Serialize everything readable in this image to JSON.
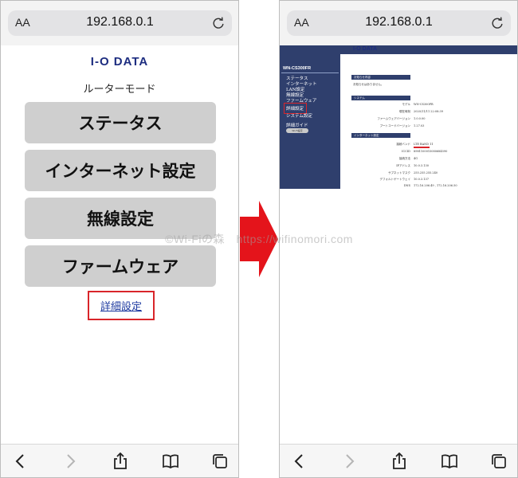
{
  "browser": {
    "url": "192.168.0.1",
    "text_size_label": "AA",
    "icons": [
      "reload-icon",
      "back-icon",
      "forward-icon",
      "share-icon",
      "bookmarks-icon",
      "tabs-icon"
    ]
  },
  "left_page": {
    "logo": "I-O DATA",
    "mode_label": "ルーターモード",
    "menu": [
      "ステータス",
      "インターネット設定",
      "無線設定",
      "ファームウェア"
    ],
    "advanced_link": "詳細設定"
  },
  "right_page": {
    "logo": "I-O DATA",
    "model": "WN-CS300FR",
    "sidebar_items": [
      "ステータス",
      "インターネット",
      "LAN設定",
      "無線設定",
      "ファームウェア",
      "詳細設定",
      "システム設定"
    ],
    "sidebar_guide": "詳細ガイド",
    "sidebar_button": "Wi-Fi設定",
    "sections": {
      "notice_title": "お知らせ内容",
      "notice_text": "お知らせはありません。",
      "system_title": "システム",
      "system_rows": [
        {
          "label": "モデル",
          "value": "WN-CS300FR"
        },
        {
          "label": "現在時刻",
          "value": "2020/11/11 22:08:39"
        },
        {
          "label": "ファームウェアバージョン",
          "value": "1.0.0.00"
        },
        {
          "label": "ブートコードバージョン",
          "value": "1.27.03"
        }
      ],
      "internet_title": "インターネット設定",
      "internet_rows": [
        {
          "label": "接続バンド",
          "value": "LTE BAND 11"
        },
        {
          "label": "ICCID",
          "value": "8981100015080684590"
        },
        {
          "label": "接続方法",
          "value": "4G"
        },
        {
          "label": "IPアドレス",
          "value": "10.0.3.130"
        },
        {
          "label": "サブネットマスク",
          "value": "255.255.255.240"
        },
        {
          "label": "デフォルトゲートウェイ",
          "value": "10.0.3.137"
        },
        {
          "label": "DNS",
          "value": "172.16.206.49 , 172.16.206.50"
        }
      ]
    }
  },
  "watermark": "©Wi-Fiの森　https://wifinomori.com",
  "colors": {
    "accent_red": "#d9252a",
    "brand_navy": "#2f3f6d",
    "button_gray": "#cfcfcf"
  }
}
